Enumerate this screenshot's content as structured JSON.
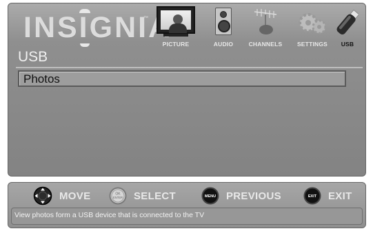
{
  "brand": {
    "logo_text": "INSIGNIA",
    "trademark": "™"
  },
  "tabs": [
    {
      "label": "PICTURE",
      "icon": "tv-picture-icon",
      "active": false
    },
    {
      "label": "AUDIO",
      "icon": "speaker-icon",
      "active": false
    },
    {
      "label": "CHANNELS",
      "icon": "antenna-icon",
      "active": false
    },
    {
      "label": "SETTINGS",
      "icon": "gears-icon",
      "active": false
    },
    {
      "label": "USB",
      "icon": "usb-drive-icon",
      "active": true
    }
  ],
  "main": {
    "section_title": "USB",
    "items": [
      {
        "label": "Photos",
        "selected": true
      }
    ]
  },
  "help": {
    "hints": [
      {
        "label": "MOVE",
        "icon": "dpad-icon"
      },
      {
        "label": "SELECT",
        "icon": "ok-enter-icon",
        "button_text": "OK ENTER"
      },
      {
        "label": "PREVIOUS",
        "icon": "menu-button-icon",
        "button_text": "MENU"
      },
      {
        "label": "EXIT",
        "icon": "exit-button-icon",
        "button_text": "EXIT"
      }
    ],
    "description": "View photos form a USB device that is connected to the TV"
  },
  "colors": {
    "panel": "#8f8f8f",
    "text_light": "#f0f0f0",
    "active_tab_label": "#111111"
  }
}
